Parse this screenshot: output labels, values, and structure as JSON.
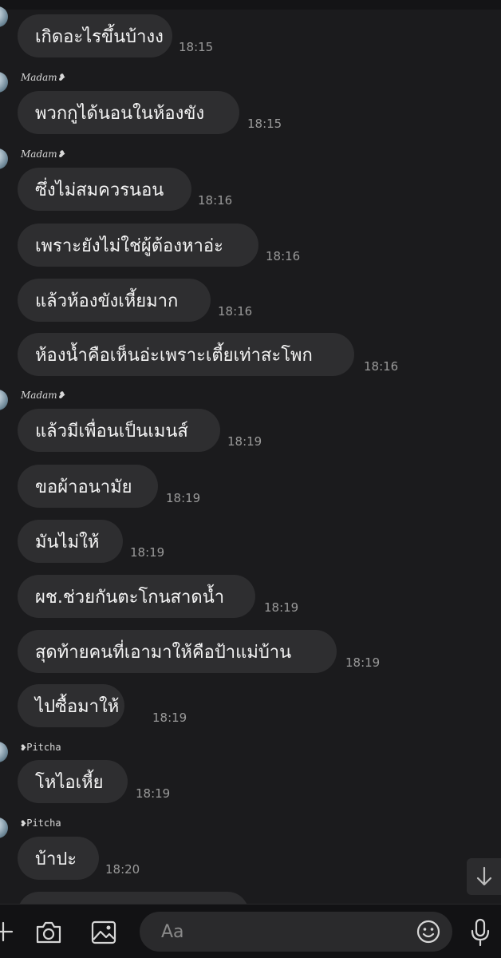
{
  "chat": {
    "messages": [
      {
        "text": "เกิดอะไรขึ้นบ้างง",
        "time": "18:15"
      },
      {
        "sender": "Madam❥",
        "text": "พวกกูได้นอนในห้องขัง",
        "time": "18:15"
      },
      {
        "sender": "Madam❥",
        "text": "ซึ่งไม่สมควรนอน",
        "time": "18:16"
      },
      {
        "text": "เพราะยังไม่ใช่ผู้ต้องหาอ่ะ",
        "time": "18:16"
      },
      {
        "text": "แล้วห้องขังเหี้ยมาก",
        "time": "18:16"
      },
      {
        "text": "ห้องน้ำคือเห็นอ่ะเพราะเตี้ยเท่าสะโพก",
        "time": "18:16"
      },
      {
        "sender": "Madam❥",
        "text": "แล้วมีเพื่อนเป็นเมนส์",
        "time": "18:19"
      },
      {
        "text": "ขอผ้าอนามัย",
        "time": "18:19"
      },
      {
        "text": "มันไม่ให้",
        "time": "18:19"
      },
      {
        "text": "ผช.ช่วยกันตะโกนสาดน้ำ",
        "time": "18:19"
      },
      {
        "text": "สุดท้ายคนที่เอามาให้คือป้าแม่บ้าน",
        "time": "18:19"
      },
      {
        "text": "ไปซื้อมาให้",
        "time": "18:19"
      },
      {
        "sender": "❥Pitcha",
        "text": "โหไอเหี้ย",
        "time": "18:19"
      },
      {
        "sender": "❥Pitcha",
        "text": "บ้าปะ",
        "time": "18:20"
      }
    ]
  },
  "composer": {
    "placeholder": "Aa",
    "icons": [
      "plus-icon",
      "camera-icon",
      "image-icon",
      "emoji-icon",
      "microphone-icon"
    ]
  },
  "scroll_down": {
    "icon": "arrow-down-icon"
  },
  "colors": {
    "background": "#1b1b1d",
    "bubble": "#2e2e30",
    "time": "#9a9a9a",
    "composer": "#121214"
  }
}
